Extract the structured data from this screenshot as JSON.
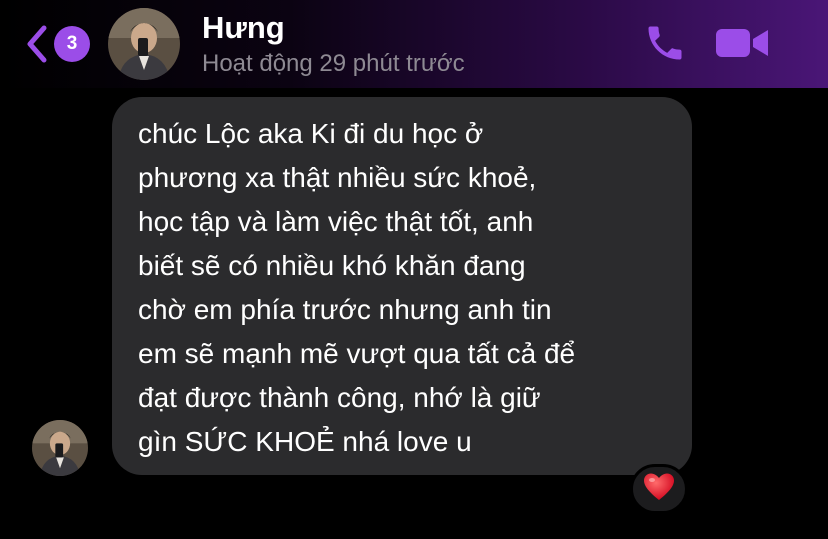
{
  "header": {
    "unread_count": "3",
    "contact_name": "Hưng",
    "status": "Hoạt động 29 phút trước",
    "icons": {
      "back": "chevron-left-icon",
      "call": "phone-icon",
      "video": "video-camera-icon"
    },
    "accent_color": "#9b4de8"
  },
  "message": {
    "lines": [
      "chúc Lộc aka Ki đi du học ở",
      "phương xa thật nhiều sức khoẻ,",
      "học tập và làm việc thật tốt, anh",
      "biết sẽ có nhiều khó khăn đang",
      "chờ em phía trước nhưng anh tin",
      "em sẽ mạnh mẽ vượt qua tất cả để",
      "đạt được thành công, nhớ là giữ",
      "gìn SỨC KHOẺ nhá love u"
    ],
    "reaction": "heart"
  }
}
